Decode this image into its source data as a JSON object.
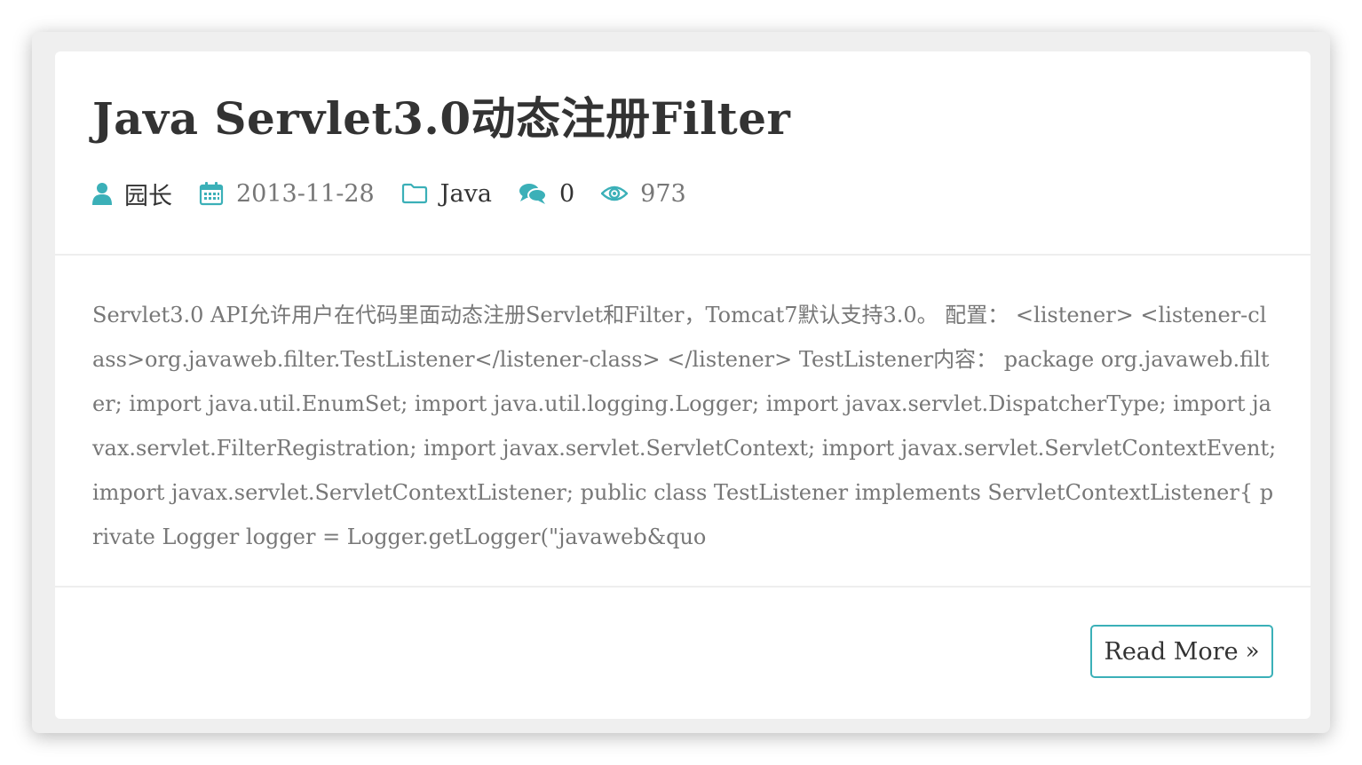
{
  "post": {
    "title": "Java Servlet3.0动态注册Filter",
    "meta": {
      "author": "园长",
      "date": "2013-11-28",
      "category": "Java",
      "comments": "0",
      "views": "973"
    },
    "excerpt": "Servlet3.0 API允许用户在代码里面动态注册Servlet和Filter，Tomcat7默认支持3.0。 配置： <listener> <listener-class>org.javaweb.filter.TestListener</listener-class> </listener> TestListener内容： package org.javaweb.filter; import java.util.EnumSet; import java.util.logging.Logger; import javax.servlet.DispatcherType; import javax.servlet.FilterRegistration; import javax.servlet.ServletContext; import javax.servlet.ServletContextEvent; import javax.servlet.ServletContextListener; public class TestListener implements ServletContextListener{ private Logger logger = Logger.getLogger(\"javaweb&quo",
    "read_more_label": "Read More",
    "read_more_glyph": "»"
  },
  "colors": {
    "accent": "#3bb0b8",
    "title": "#333333",
    "muted": "#777777"
  },
  "icons": [
    "user-icon",
    "calendar-icon",
    "folder-icon",
    "comments-icon",
    "eye-icon",
    "double-chevron-right-icon"
  ]
}
